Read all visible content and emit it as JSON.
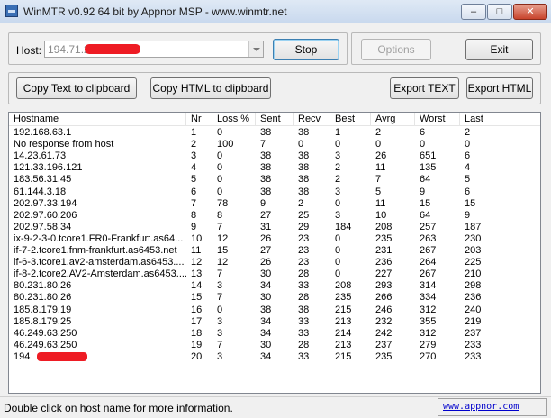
{
  "window": {
    "title": "WinMTR v0.92 64 bit by Appnor MSP - www.winmtr.net",
    "min_glyph": "–",
    "max_glyph": "□",
    "close_glyph": "✕",
    "icon": "app-icon"
  },
  "toolbar": {
    "host_label": "Host:",
    "host_value": "194.71.2",
    "stop_label": "Stop",
    "options_label": "Options",
    "exit_label": "Exit",
    "copy_text_label": "Copy Text to clipboard",
    "copy_html_label": "Copy HTML to clipboard",
    "export_text_label": "Export TEXT",
    "export_html_label": "Export HTML"
  },
  "table": {
    "headers": [
      "Hostname",
      "Nr",
      "Loss %",
      "Sent",
      "Recv",
      "Best",
      "Avrg",
      "Worst",
      "Last"
    ],
    "rows": [
      [
        "192.168.63.1",
        "1",
        "0",
        "38",
        "38",
        "1",
        "2",
        "6",
        "2"
      ],
      [
        "No response from host",
        "2",
        "100",
        "7",
        "0",
        "0",
        "0",
        "0",
        "0"
      ],
      [
        "14.23.61.73",
        "3",
        "0",
        "38",
        "38",
        "3",
        "26",
        "651",
        "6"
      ],
      [
        "121.33.196.121",
        "4",
        "0",
        "38",
        "38",
        "2",
        "11",
        "135",
        "4"
      ],
      [
        "183.56.31.45",
        "5",
        "0",
        "38",
        "38",
        "2",
        "7",
        "64",
        "5"
      ],
      [
        "61.144.3.18",
        "6",
        "0",
        "38",
        "38",
        "3",
        "5",
        "9",
        "6"
      ],
      [
        "202.97.33.194",
        "7",
        "78",
        "9",
        "2",
        "0",
        "11",
        "15",
        "15"
      ],
      [
        "202.97.60.206",
        "8",
        "8",
        "27",
        "25",
        "3",
        "10",
        "64",
        "9"
      ],
      [
        "202.97.58.34",
        "9",
        "7",
        "31",
        "29",
        "184",
        "208",
        "257",
        "187"
      ],
      [
        "ix-9-2-3-0.tcore1.FR0-Frankfurt.as64...",
        "10",
        "12",
        "26",
        "23",
        "0",
        "235",
        "263",
        "230"
      ],
      [
        "if-7-2.tcore1.fnm-frankfurt.as6453.net",
        "11",
        "15",
        "27",
        "23",
        "0",
        "231",
        "267",
        "203"
      ],
      [
        "if-6-3.tcore1.av2-amsterdam.as6453....",
        "12",
        "12",
        "26",
        "23",
        "0",
        "236",
        "264",
        "225"
      ],
      [
        "if-8-2.tcore2.AV2-Amsterdam.as6453....",
        "13",
        "7",
        "30",
        "28",
        "0",
        "227",
        "267",
        "210"
      ],
      [
        "80.231.80.26",
        "14",
        "3",
        "34",
        "33",
        "208",
        "293",
        "314",
        "298"
      ],
      [
        "80.231.80.26",
        "15",
        "7",
        "30",
        "28",
        "235",
        "266",
        "334",
        "236"
      ],
      [
        "185.8.179.19",
        "16",
        "0",
        "38",
        "38",
        "215",
        "246",
        "312",
        "240"
      ],
      [
        "185.8.179.25",
        "17",
        "3",
        "34",
        "33",
        "213",
        "232",
        "355",
        "219"
      ],
      [
        "46.249.63.250",
        "18",
        "3",
        "34",
        "33",
        "214",
        "242",
        "312",
        "237"
      ],
      [
        "46.249.63.250",
        "19",
        "7",
        "30",
        "28",
        "213",
        "237",
        "279",
        "233"
      ],
      [
        "194",
        "20",
        "3",
        "34",
        "33",
        "215",
        "235",
        "270",
        "233"
      ]
    ]
  },
  "status": {
    "text": "Double click on host name for more information.",
    "link": "www.appnor.com"
  }
}
